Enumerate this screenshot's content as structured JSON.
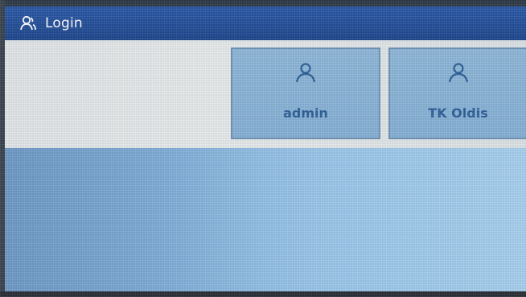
{
  "header": {
    "icon": "user-icon",
    "title": "Login"
  },
  "users": [
    {
      "name": "admin",
      "icon": "user-icon"
    },
    {
      "name": "TK Oldis",
      "icon": "user-icon"
    }
  ],
  "colors": {
    "header_bg": "#2a5aa8",
    "tile_bg": "#8fb8da",
    "tile_text": "#2d5f98",
    "content_bg": "#9ac6ea"
  }
}
